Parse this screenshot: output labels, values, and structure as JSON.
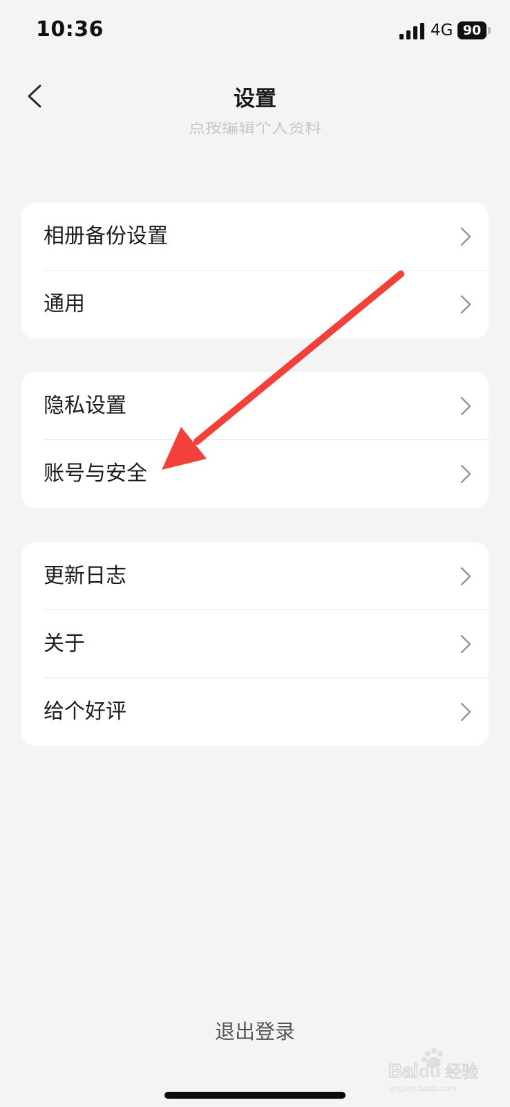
{
  "status_bar": {
    "time": "10:36",
    "network": "4G",
    "battery": "90"
  },
  "header": {
    "title": "设置",
    "back_icon": "chevron-left-icon"
  },
  "partially_hidden_text": "点按编辑个人资料",
  "groups": [
    {
      "items": [
        {
          "label": "相册备份设置",
          "icon": "chevron-right-icon"
        },
        {
          "label": "通用",
          "icon": "chevron-right-icon"
        }
      ]
    },
    {
      "items": [
        {
          "label": "隐私设置",
          "icon": "chevron-right-icon"
        },
        {
          "label": "账号与安全",
          "icon": "chevron-right-icon"
        }
      ]
    },
    {
      "items": [
        {
          "label": "更新日志",
          "icon": "chevron-right-icon"
        },
        {
          "label": "关于",
          "icon": "chevron-right-icon"
        },
        {
          "label": "给个好评",
          "icon": "chevron-right-icon"
        }
      ]
    }
  ],
  "logout_label": "退出登录",
  "annotation": {
    "type": "arrow",
    "color": "#f2413a",
    "points_to": "账号与安全"
  },
  "watermark": {
    "text": "Baidu经验",
    "subtext": "jingyan.baidu.com"
  },
  "colors": {
    "background": "#f4f4f4",
    "card": "#ffffff",
    "text": "#1c1c1c",
    "chevron": "#8a8a8a",
    "arrow": "#f2413a"
  }
}
